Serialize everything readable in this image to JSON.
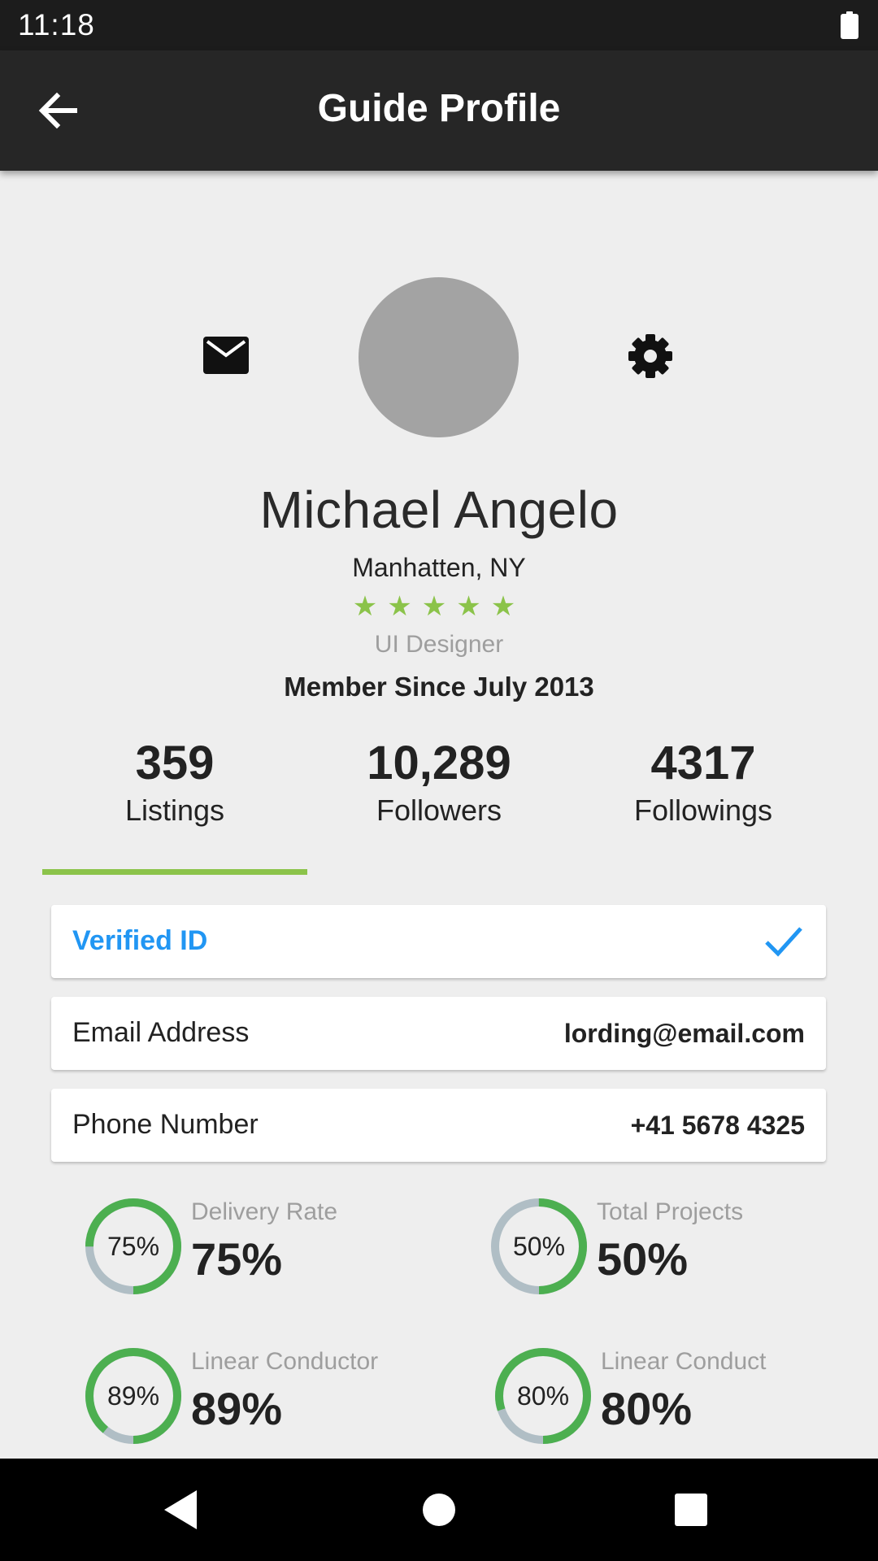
{
  "status_bar": {
    "time": "11:18",
    "icons": [
      "battery-icon"
    ]
  },
  "app_bar": {
    "title": "Guide Profile",
    "back_icon": "arrow-back-icon"
  },
  "profile": {
    "name": "Michael Angelo",
    "location": "Manhatten, NY",
    "rating": 5,
    "rating_max": 5,
    "role": "UI Designer",
    "member_since": "Member Since July 2013"
  },
  "header_icons": {
    "mail": "mail-icon",
    "settings": "gear-icon"
  },
  "stats": [
    {
      "value": "359",
      "label": "Listings"
    },
    {
      "value": "10,289",
      "label": "Followers"
    },
    {
      "value": "4317",
      "label": "Followings"
    }
  ],
  "active_stat_index": 0,
  "cards": {
    "verified": {
      "label": "Verified ID",
      "icon": "check-icon"
    },
    "email": {
      "label": "Email Address",
      "value": "lording@email.com"
    },
    "phone": {
      "label": "Phone Number",
      "value": "+41 5678 4325"
    }
  },
  "metrics": [
    {
      "ring_text": "75%",
      "label": "Delivery Rate",
      "value": "75%",
      "percent": 75
    },
    {
      "ring_text": "50%",
      "label": "Total Projects",
      "value": "50%",
      "percent": 50
    },
    {
      "ring_text": "89%",
      "label": "Linear Conductor",
      "value": "89%",
      "percent": 89
    },
    {
      "ring_text": "80%",
      "label": "Linear Conduct",
      "value": "80%",
      "percent": 80
    }
  ],
  "colors": {
    "accent_green": "#8bc34a",
    "ring_green": "#4caf50",
    "ring_track": "#b0bec5",
    "verified_blue": "#2196f3",
    "app_bar": "#262626"
  },
  "nav_bar": {
    "back": "nav-back-icon",
    "home": "nav-home-icon",
    "recents": "nav-recents-icon"
  }
}
